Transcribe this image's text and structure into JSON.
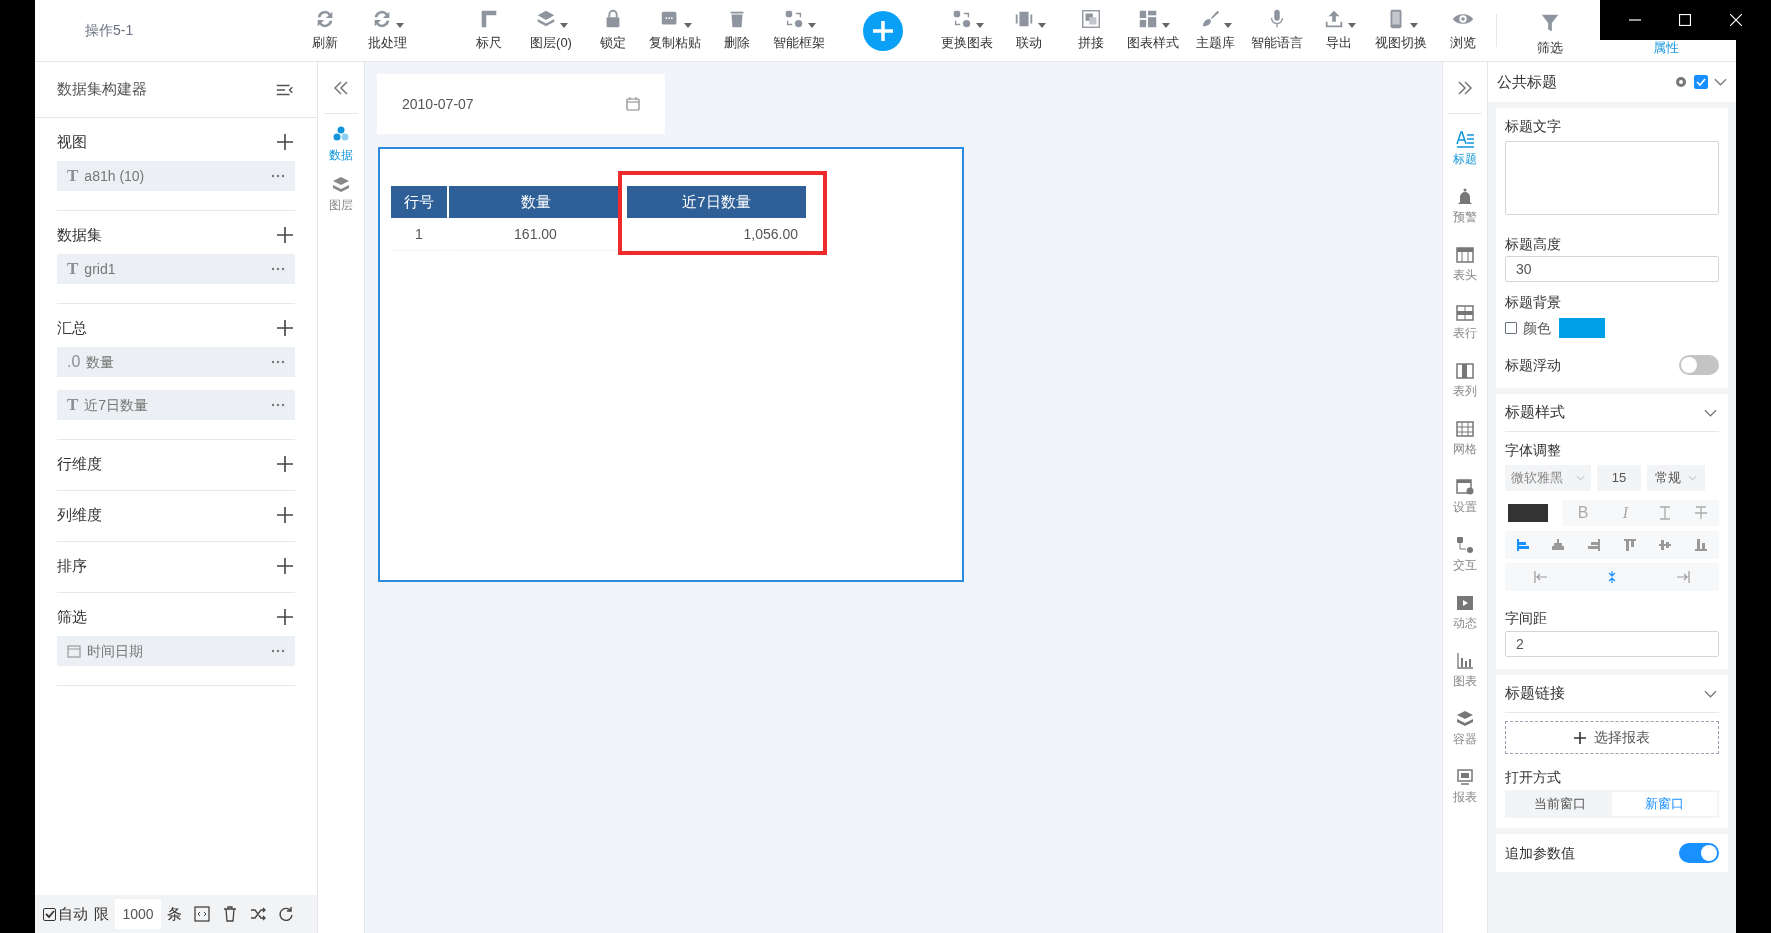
{
  "window": {
    "title": "操作5-1"
  },
  "toolbar": {
    "items": [
      {
        "label": "刷新",
        "dropdown": false
      },
      {
        "label": "批处理",
        "dropdown": true
      },
      {
        "label": "标尺",
        "dropdown": false
      },
      {
        "label": "图层(0)",
        "dropdown": true
      },
      {
        "label": "锁定",
        "dropdown": false
      },
      {
        "label": "复制粘贴",
        "dropdown": true
      },
      {
        "label": "删除",
        "dropdown": false
      },
      {
        "label": "智能框架",
        "dropdown": true
      },
      {
        "label": "更换图表",
        "dropdown": true
      },
      {
        "label": "联动",
        "dropdown": true
      },
      {
        "label": "拼接",
        "dropdown": false
      },
      {
        "label": "图表样式",
        "dropdown": true
      },
      {
        "label": "主题库",
        "dropdown": true
      },
      {
        "label": "智能语言",
        "dropdown": false
      },
      {
        "label": "导出",
        "dropdown": true
      },
      {
        "label": "视图切换",
        "dropdown": true
      },
      {
        "label": "浏览",
        "dropdown": false
      }
    ],
    "tabs": [
      {
        "label": "筛选",
        "selected": false
      },
      {
        "label": "属性",
        "selected": true
      }
    ]
  },
  "left_panel": {
    "title": "数据集构建器",
    "sections": [
      {
        "label": "视图",
        "items": [
          {
            "kind": "field",
            "prefix": "T",
            "label": "a81h (10)"
          }
        ]
      },
      {
        "label": "数据集",
        "items": [
          {
            "kind": "field",
            "prefix": "T",
            "label": "grid1"
          }
        ]
      },
      {
        "label": "汇总",
        "items": [
          {
            "kind": "field",
            "prefix": ".0",
            "label": "数量"
          },
          {
            "kind": "field",
            "prefix": "T",
            "label": "近7日数量"
          }
        ]
      },
      {
        "label": "行维度"
      },
      {
        "label": "列维度"
      },
      {
        "label": "排序"
      },
      {
        "label": "筛选",
        "items": [
          {
            "kind": "date",
            "label": "时间日期"
          }
        ]
      }
    ],
    "footer": {
      "auto_label": "自动",
      "auto_checked": true,
      "limit_label": "限",
      "limit": "1000",
      "unit": "条"
    }
  },
  "side_tabs": [
    {
      "label": "数据",
      "selected": true
    },
    {
      "label": "图层",
      "selected": false
    }
  ],
  "canvas": {
    "date_filter": {
      "value": "2010-07-07"
    },
    "table": {
      "columns": [
        {
          "label": "行号",
          "highlighted": false
        },
        {
          "label": "数量",
          "highlighted": false
        },
        {
          "label": "近7日数量",
          "highlighted": true
        }
      ],
      "rows": [
        [
          "1",
          "161.00",
          "1,056.00"
        ]
      ]
    }
  },
  "property_tabs": [
    {
      "label": "标题",
      "selected": true
    },
    {
      "label": "预警",
      "selected": false
    },
    {
      "label": "表头",
      "selected": false
    },
    {
      "label": "表行",
      "selected": false
    },
    {
      "label": "表列",
      "selected": false
    },
    {
      "label": "网格",
      "selected": false
    },
    {
      "label": "设置",
      "selected": false
    },
    {
      "label": "交互",
      "selected": false
    },
    {
      "label": "动态",
      "selected": false
    },
    {
      "label": "图表",
      "selected": false
    },
    {
      "label": "容器",
      "selected": false
    },
    {
      "label": "报表",
      "selected": false
    }
  ],
  "properties": {
    "header": {
      "title": "公共标题",
      "checked": true
    },
    "title_text": {
      "label": "标题文字"
    },
    "title_height": {
      "label": "标题高度",
      "value": "30"
    },
    "title_background": {
      "label": "标题背景",
      "option": "颜色",
      "checked": false,
      "color": "#00a0e9"
    },
    "title_float": {
      "label": "标题浮动",
      "on": false
    },
    "style": {
      "title": "标题样式",
      "expanded": true,
      "font_label": "字体调整",
      "font": "微软雅黑",
      "size": "15",
      "weight": "常规",
      "color": "#333333",
      "format_buttons": [
        "B",
        "I"
      ],
      "align_buttons": [
        {
          "selected": true
        },
        {
          "selected": false
        },
        {
          "selected": false
        },
        {
          "selected": false
        },
        {
          "selected": false
        },
        {
          "selected": false
        }
      ],
      "spacing_buttons": [
        {
          "selected": false
        },
        {
          "selected": true
        },
        {
          "selected": false
        }
      ],
      "letter_spacing_label": "字间距",
      "letter_spacing": "2"
    },
    "link": {
      "title": "标题链接",
      "expanded": true,
      "button": "选择报表",
      "open_label": "打开方式",
      "open_options": [
        {
          "label": "当前窗口",
          "selected": false
        },
        {
          "label": "新窗口",
          "selected": true
        }
      ]
    },
    "append_params": {
      "label": "追加参数值",
      "on": true
    }
  }
}
